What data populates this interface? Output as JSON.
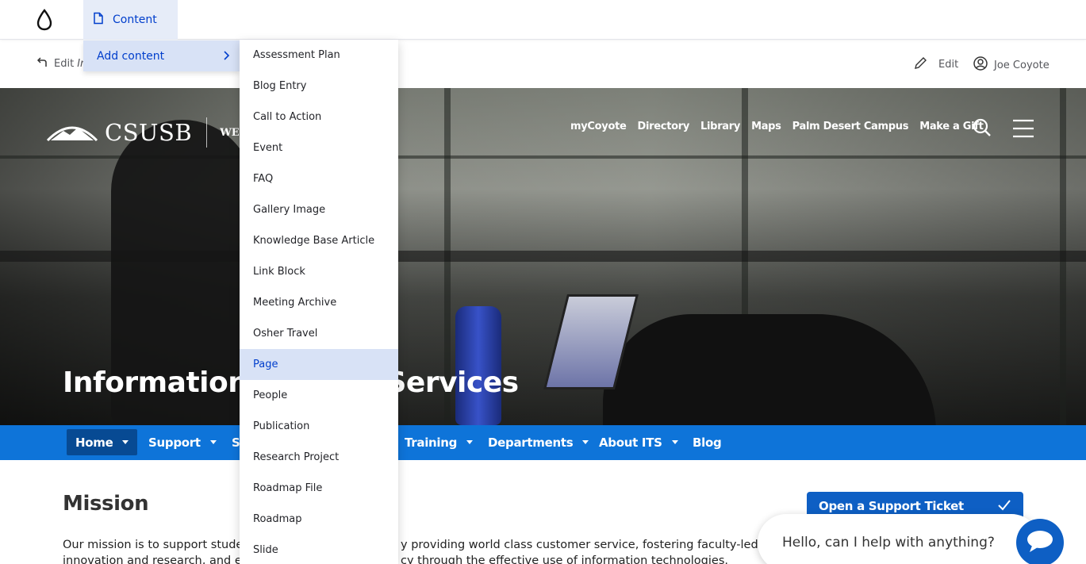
{
  "admin": {
    "content_label": "Content",
    "add_content_label": "Add content",
    "edit_back_label": "Edit",
    "edit_back_suffix": "In",
    "edit_label": "Edit",
    "user_name": "Joe Coyote"
  },
  "dropdown": {
    "items": [
      "Assessment Plan",
      "Blog Entry",
      "Call to Action",
      "Event",
      "FAQ",
      "Gallery Image",
      "Knowledge Base Article",
      "Link Block",
      "Meeting Archive",
      "Osher Travel",
      "Page",
      "People",
      "Publication",
      "Research Project",
      "Roadmap File",
      "Roadmap",
      "Slide"
    ],
    "active_index": 10
  },
  "brand": {
    "name": "CSUSB",
    "tagline": "WE DE"
  },
  "topnav": [
    "myCoyote",
    "Directory",
    "Library",
    "Maps",
    "Palm Desert Campus",
    "Make a Gift"
  ],
  "hero": {
    "title_left": "Information T",
    "title_right": "Services"
  },
  "main_nav": {
    "items": [
      {
        "label": "Home",
        "dropdown": true
      },
      {
        "label": "Support",
        "dropdown": true
      },
      {
        "label": "S",
        "dropdown": false
      },
      {
        "label": "Training",
        "dropdown": true
      },
      {
        "label": "Departments",
        "dropdown": true
      },
      {
        "label": "About ITS",
        "dropdown": true
      },
      {
        "label": "Blog",
        "dropdown": false
      }
    ]
  },
  "mission": {
    "title": "Mission",
    "line1_left": "Our mission is to support studer",
    "line1_right": "y providing world class customer service, fostering faculty-led",
    "line2_left": "innovation and research, and en",
    "line2_right": "cy through the effective use of information technologies."
  },
  "support_ticket": {
    "label": "Open a Support Ticket"
  },
  "chat": {
    "prompt": "Hello, can I help with anything?"
  },
  "colors": {
    "accent": "#003ecc",
    "nav_blue": "#0e74d9",
    "nav_active": "#074a93",
    "support_blue": "#0e5fc4"
  }
}
